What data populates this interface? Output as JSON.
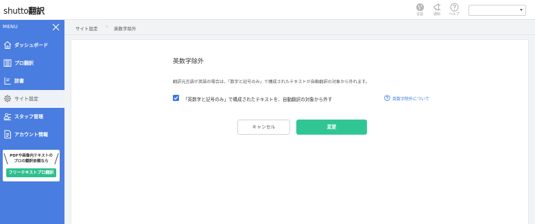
{
  "app": {
    "logo_main": "shutto",
    "logo_sub": "翻訳"
  },
  "header": {
    "language_label": "言語",
    "notification_label": "通知",
    "help_label": "ヘルプ",
    "site_select_value": ""
  },
  "sidebar": {
    "menu_title": "MENU",
    "items": [
      {
        "label": "ダッシュボード",
        "icon": "home-icon"
      },
      {
        "label": "プロ翻訳",
        "icon": "document-columns-icon"
      },
      {
        "label": "辞書",
        "icon": "dictionary-icon"
      },
      {
        "label": "サイト設定",
        "icon": "gear-icon",
        "active": true
      },
      {
        "label": "スタッフ管理",
        "icon": "staff-icon"
      },
      {
        "label": "アカウント情報",
        "icon": "account-document-icon"
      }
    ],
    "promo": {
      "line1": "PDFや画像内テキストの",
      "line2": "プロの翻訳依頼なら",
      "button": "フリーテキストプロ翻訳"
    }
  },
  "breadcrumb": {
    "parent": "サイト設定",
    "current": "英数字除外"
  },
  "main": {
    "title": "英数字除外",
    "description": "翻訳元言語が英語の場合は、「数字と記号のみ」で構成されたテキストが自動翻訳の対象から外れます。",
    "checkbox_label": "「英数字と記号のみ」で構成されたテキストを、自動翻訳の対象から外す",
    "checkbox_checked": true,
    "help_link": "英数字除外について",
    "cancel_label": "キャンセル",
    "save_label": "変更"
  },
  "colors": {
    "sidebar_bg": "#4a7de0",
    "accent_green": "#2fc694",
    "link_blue": "#3b78e7"
  }
}
